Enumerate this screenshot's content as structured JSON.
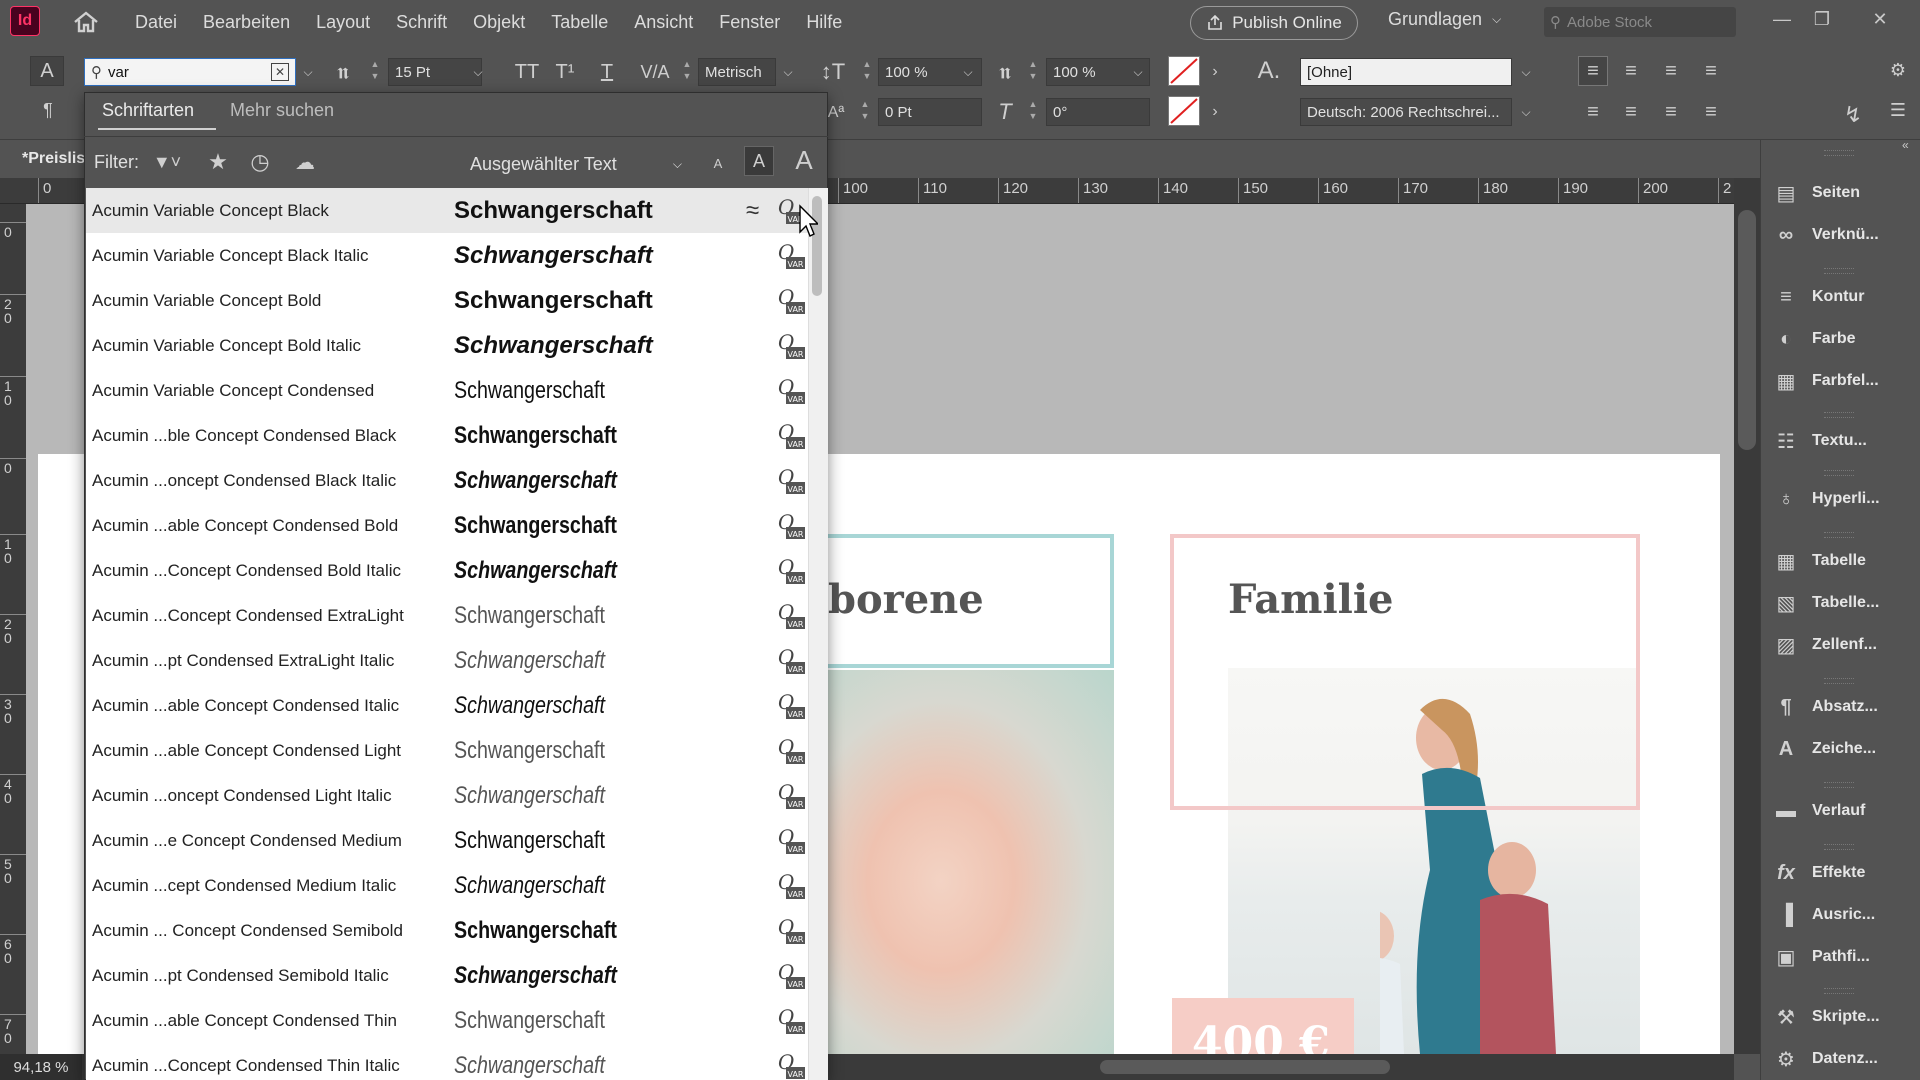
{
  "app": {
    "logo": "Id"
  },
  "menubar": {
    "items": [
      "Datei",
      "Bearbeiten",
      "Layout",
      "Schrift",
      "Objekt",
      "Tabelle",
      "Ansicht",
      "Fenster",
      "Hilfe"
    ],
    "publish": "Publish Online",
    "workspace": "Grundlagen",
    "stock_placeholder": "Adobe Stock"
  },
  "control": {
    "font_search": "var",
    "font_size": "15 Pt",
    "units": "Metrisch",
    "vscale": "100 %",
    "hscale": "100 %",
    "baseline": "0 Pt",
    "skew": "0°",
    "char_style": "[Ohne]",
    "language": "Deutsch: 2006 Rechtschrei..."
  },
  "dropdown": {
    "tabs": [
      "Schriftarten",
      "Mehr suchen"
    ],
    "filter_label": "Filter:",
    "preview_select": "Ausgewählter Text",
    "sample": "Schwangerschaft",
    "fonts": [
      {
        "name": "Acumin Variable Concept Black",
        "w": "900",
        "i": false,
        "c": false
      },
      {
        "name": "Acumin Variable Concept Black Italic",
        "w": "900",
        "i": true,
        "c": false
      },
      {
        "name": "Acumin Variable Concept Bold",
        "w": "700",
        "i": false,
        "c": false
      },
      {
        "name": "Acumin Variable Concept Bold Italic",
        "w": "700",
        "i": true,
        "c": false
      },
      {
        "name": "Acumin Variable Concept Condensed",
        "w": "400",
        "i": false,
        "c": true
      },
      {
        "name": "Acumin ...ble Concept Condensed Black",
        "w": "900",
        "i": false,
        "c": true
      },
      {
        "name": "Acumin ...oncept Condensed Black Italic",
        "w": "900",
        "i": true,
        "c": true
      },
      {
        "name": "Acumin ...able Concept Condensed Bold",
        "w": "700",
        "i": false,
        "c": true
      },
      {
        "name": "Acumin ...Concept Condensed Bold Italic",
        "w": "700",
        "i": true,
        "c": true
      },
      {
        "name": "Acumin ...Concept Condensed ExtraLight",
        "w": "200",
        "i": false,
        "c": true
      },
      {
        "name": "Acumin ...pt Condensed ExtraLight Italic",
        "w": "200",
        "i": true,
        "c": true
      },
      {
        "name": "Acumin ...able Concept Condensed Italic",
        "w": "400",
        "i": true,
        "c": true
      },
      {
        "name": "Acumin ...able Concept Condensed Light",
        "w": "300",
        "i": false,
        "c": true
      },
      {
        "name": "Acumin ...oncept Condensed Light Italic",
        "w": "300",
        "i": true,
        "c": true
      },
      {
        "name": "Acumin ...e Concept Condensed Medium",
        "w": "500",
        "i": false,
        "c": true
      },
      {
        "name": "Acumin ...cept Condensed Medium Italic",
        "w": "500",
        "i": true,
        "c": true
      },
      {
        "name": "Acumin ... Concept Condensed Semibold",
        "w": "600",
        "i": false,
        "c": true
      },
      {
        "name": "Acumin ...pt Condensed Semibold Italic",
        "w": "600",
        "i": true,
        "c": true
      },
      {
        "name": "Acumin ...able Concept Condensed Thin",
        "w": "100",
        "i": false,
        "c": true
      },
      {
        "name": "Acumin ...Concept Condensed Thin Italic",
        "w": "100",
        "i": true,
        "c": true
      }
    ]
  },
  "document": {
    "tab": "*Preislis",
    "zoom": "94,18 %",
    "card1_title": "borene",
    "card2_title": "Familie",
    "price": "400 €"
  },
  "ruler": {
    "h": [
      "0",
      "100",
      "110",
      "120",
      "130",
      "140",
      "150",
      "160",
      "170",
      "180",
      "190",
      "200",
      "2"
    ],
    "v": [
      "0",
      "20",
      "10",
      "0",
      "10",
      "20",
      "30",
      "40",
      "50",
      "60",
      "70"
    ]
  },
  "panels": [
    {
      "label": "Seiten",
      "icon": "pages-icon"
    },
    {
      "label": "Verknü...",
      "icon": "links-icon"
    },
    {
      "label": "Kontur",
      "icon": "stroke-icon"
    },
    {
      "label": "Farbe",
      "icon": "color-icon"
    },
    {
      "label": "Farbfel...",
      "icon": "swatches-icon"
    },
    {
      "label": "Textu...",
      "icon": "text-wrap-icon"
    },
    {
      "label": "Hyperli...",
      "icon": "hyperlinks-icon"
    },
    {
      "label": "Tabelle",
      "icon": "table-icon"
    },
    {
      "label": "Tabelle...",
      "icon": "table-styles-icon"
    },
    {
      "label": "Zellenf...",
      "icon": "cell-styles-icon"
    },
    {
      "label": "Absatz...",
      "icon": "paragraph-styles-icon"
    },
    {
      "label": "Zeiche...",
      "icon": "character-styles-icon"
    },
    {
      "label": "Verlauf",
      "icon": "gradient-icon"
    },
    {
      "label": "Effekte",
      "icon": "effects-icon"
    },
    {
      "label": "Ausric...",
      "icon": "align-icon"
    },
    {
      "label": "Pathfi...",
      "icon": "pathfinder-icon"
    },
    {
      "label": "Skripte...",
      "icon": "scripts-icon"
    },
    {
      "label": "Datenz...",
      "icon": "data-merge-icon"
    }
  ]
}
